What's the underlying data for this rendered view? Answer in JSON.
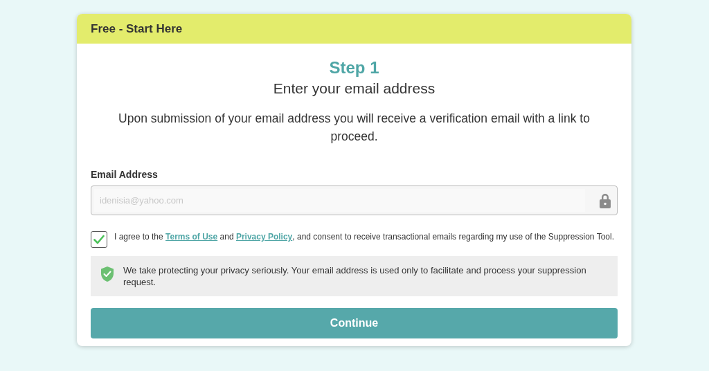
{
  "card": {
    "header": "Free - Start Here"
  },
  "step": "Step 1",
  "heading": "Enter your email address",
  "intro": "Upon submission of your email address you will receive a verification email with a link to proceed.",
  "email_field": {
    "label": "Email Address",
    "value": "idenisia@yahoo.com"
  },
  "consent": {
    "checked": true,
    "parts": [
      {
        "kind": "text",
        "text": "I agree to the "
      },
      {
        "kind": "link",
        "text": "Terms of Use"
      },
      {
        "kind": "text",
        "text": " and "
      },
      {
        "kind": "link",
        "text": "Privacy Policy"
      },
      {
        "kind": "text",
        "text": ", and consent to receive transactional emails regarding my use of the Suppression Tool."
      }
    ]
  },
  "privacy_notice": "We take protecting your privacy seriously. Your email address is used only to facilitate and process your suppression request.",
  "buttons": [
    "Continue"
  ]
}
